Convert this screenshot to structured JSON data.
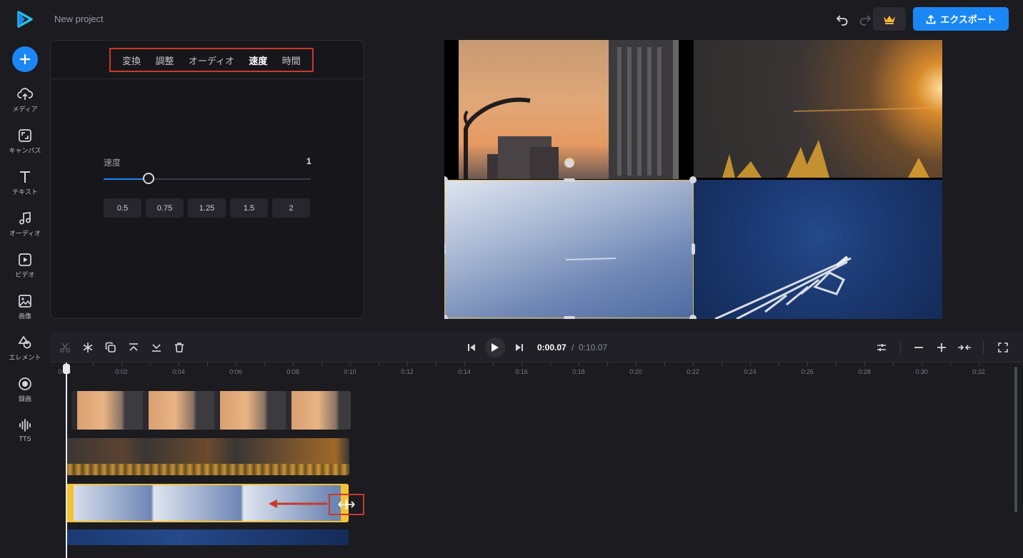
{
  "header": {
    "project_name": "New project",
    "export_label": "エクスポート",
    "accent_color": "#1b87f5"
  },
  "sidebar": {
    "items": [
      {
        "label": "メディア",
        "icon": "upload-cloud-icon"
      },
      {
        "label": "キャンバス",
        "icon": "canvas-resize-icon"
      },
      {
        "label": "テキスト",
        "icon": "text-t-icon"
      },
      {
        "label": "オーディオ",
        "icon": "music-note-icon"
      },
      {
        "label": "ビデオ",
        "icon": "video-play-icon"
      },
      {
        "label": "画像",
        "icon": "image-icon"
      },
      {
        "label": "エレメント",
        "icon": "shapes-icon"
      },
      {
        "label": "録画",
        "icon": "record-icon"
      },
      {
        "label": "TTS",
        "icon": "waveform-icon"
      }
    ]
  },
  "properties": {
    "tabs": [
      {
        "label": "変換",
        "active": false
      },
      {
        "label": "調整",
        "active": false
      },
      {
        "label": "オーディオ",
        "active": false
      },
      {
        "label": "速度",
        "active": true
      },
      {
        "label": "時間",
        "active": false
      }
    ],
    "speed_label": "速度",
    "speed_value": "1",
    "speed_fraction": 0.2,
    "presets": [
      "0.5",
      "0.75",
      "1.25",
      "1.5",
      "2"
    ]
  },
  "timeline": {
    "current_time": "0:00.07",
    "separator": "/",
    "total_time": "0:10.07",
    "ruler_labels": [
      "0:00",
      "0:02",
      "0:04",
      "0:06",
      "0:08",
      "0:10",
      "0:12",
      "0:14",
      "0:16",
      "0:18",
      "0:20",
      "0:22",
      "0:24",
      "0:26",
      "0:28",
      "0:30",
      "0:32"
    ],
    "selected_clip_color": "#f5c233"
  },
  "annotations": {
    "highlight_color": "#c8392b"
  }
}
